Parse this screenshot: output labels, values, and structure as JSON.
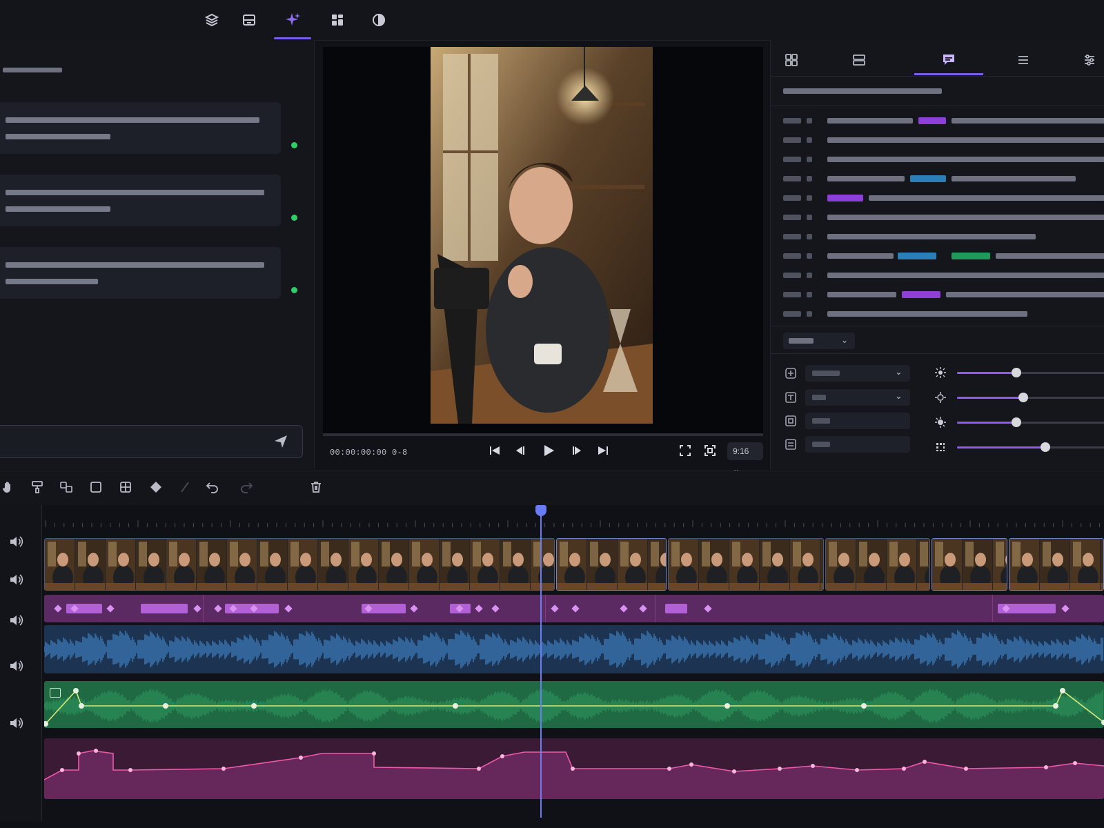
{
  "window": {
    "title": ""
  },
  "top_tabs": [
    {
      "icon": "layers-icon"
    },
    {
      "icon": "media-library-icon"
    },
    {
      "icon": "ai-sparkle-icon",
      "active": true
    },
    {
      "icon": "templates-grid-icon"
    },
    {
      "icon": "color-wheel-icon"
    }
  ],
  "preview": {
    "timecode": "00:00:00:00 0-8",
    "aspect_ratio": "9:16"
  },
  "right_tabs": [
    {
      "icon": "layout-icon"
    },
    {
      "icon": "scenes-icon"
    },
    {
      "icon": "captions-icon",
      "active": true
    },
    {
      "icon": "list-icon"
    },
    {
      "icon": "adjust-sliders-icon"
    }
  ],
  "adjustments": {
    "brightness": 0.4,
    "contrast": 0.45,
    "saturation": 0.4,
    "sharpness": 0.6
  },
  "colors": {
    "accent": "#7b5cf0",
    "status_ok": "#2fcf68",
    "video_track": "#4b5a80",
    "overlay_track": "#5b2a63",
    "audio_track": "#1d3352",
    "music_track": "#1f6a43",
    "fx_track": "#3a1a35",
    "playhead": "#6a7cf5"
  }
}
